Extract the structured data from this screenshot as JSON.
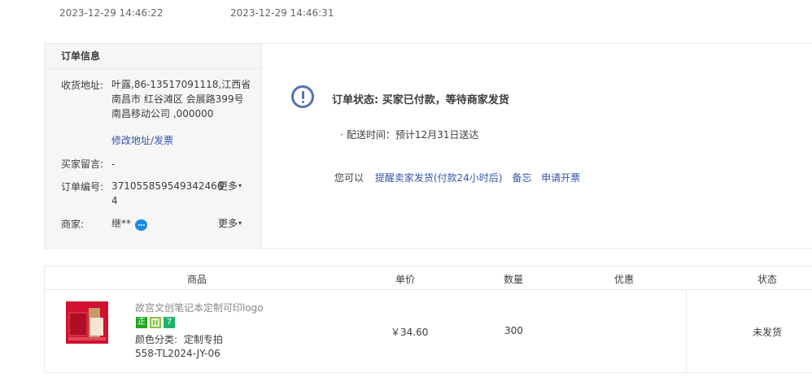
{
  "times": [
    "2023-12-29 14:46:22",
    "2023-12-29 14:46:31"
  ],
  "order_info": {
    "title": "订单信息",
    "address_label": "收货地址:",
    "address_lines": [
      "叶露,86-13517091118,江西省",
      "南昌市 红谷滩区 会展路399号",
      "南昌移动公司 ,000000"
    ],
    "edit_address_link": "修改地址/发票",
    "message_label": "买家留言:",
    "message_value": "-",
    "order_no_label": "订单编号:",
    "order_no_lines": [
      "371055859549342466",
      "4"
    ],
    "seller_label": "商家:",
    "seller_value": "继**",
    "more_label": "更多"
  },
  "order_status": {
    "status_text": "订单状态: 买家已付款，等待商家发货",
    "delivery_text": "配送时间：预计12月31日送达",
    "can_label": "您可以",
    "actions": [
      "提醒卖家发货(付款24小时后)",
      "备忘",
      "申请开票"
    ]
  },
  "table": {
    "headers": [
      "商品",
      "单价",
      "数量",
      "优惠",
      "状态"
    ],
    "rows": [
      {
        "title": "故宫文创笔记本定制可印logo",
        "badges": [
          "正",
          "",
          "7"
        ],
        "spec_label": "颜色分类:",
        "spec_value": "定制专拍",
        "sku": "558-TL2024-JY-06",
        "price": "￥34.60",
        "quantity": "300",
        "discount": "",
        "status": "未发货"
      }
    ]
  },
  "colors": {
    "link": "#3355aa",
    "status_icon": "#5573b0",
    "badge_zheng": "#1fa81f",
    "badge_7": "#20b36a",
    "chat_icon": "#1e88e5"
  }
}
